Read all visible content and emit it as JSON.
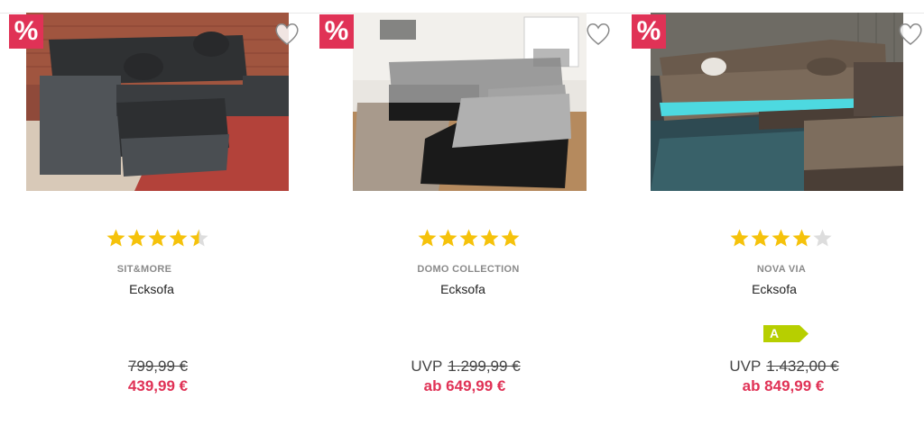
{
  "colors": {
    "sale": "#e03256",
    "star": "#f5c20b",
    "star_empty": "#dddddd",
    "energy": "#b7cf00"
  },
  "products": [
    {
      "sale_badge": "%",
      "rating": 4.5,
      "brand": "SIT&MORE",
      "name": "Ecksofa",
      "uvp_label": "",
      "old_price": "799,99 €",
      "new_price": "439,99 €",
      "image_icon": "grey-corner-sofa-photo"
    },
    {
      "sale_badge": "%",
      "rating": 5,
      "brand": "DOMO COLLECTION",
      "name": "Ecksofa",
      "uvp_label": "UVP",
      "old_price": "1.299,99 €",
      "new_price": "ab 649,99 €",
      "image_icon": "two-tone-corner-sofa-photo"
    },
    {
      "sale_badge": "%",
      "rating": 4,
      "brand": "NOVA VIA",
      "name": "Ecksofa",
      "energy_label": "A",
      "uvp_label": "UVP",
      "old_price": "1.432,00 €",
      "new_price": "ab 849,99 €",
      "image_icon": "brown-corner-sofa-led-photo"
    }
  ]
}
